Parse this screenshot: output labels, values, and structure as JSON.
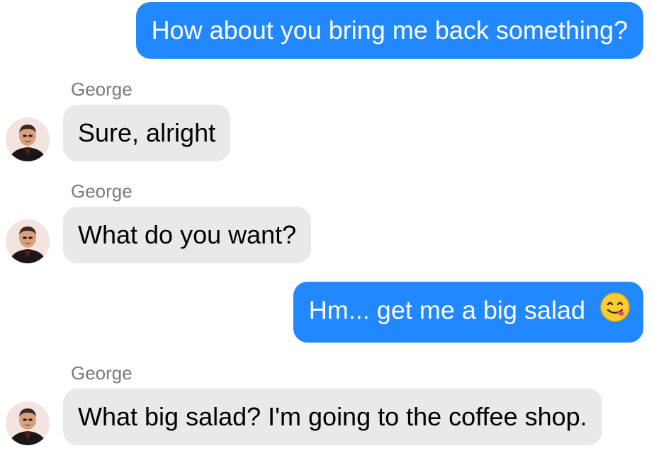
{
  "conversation": {
    "messages": [
      {
        "direction": "outgoing",
        "text": "How about you bring me back something?"
      },
      {
        "direction": "incoming",
        "sender": "George",
        "text": "Sure, alright",
        "avatar_icon": "avatar-george-icon"
      },
      {
        "direction": "incoming",
        "sender": "George",
        "text": "What do you want?",
        "avatar_icon": "avatar-george-icon"
      },
      {
        "direction": "outgoing",
        "text": "Hm... get me a big salad",
        "emoji_icon": "face-savoring-food-emoji-icon"
      },
      {
        "direction": "incoming",
        "sender": "George",
        "text": "What big salad? I'm going to the coffee shop.",
        "avatar_icon": "avatar-george-icon"
      }
    ]
  },
  "colors": {
    "outgoing_bubble": "#2188ff",
    "incoming_bubble": "#e9e9eb",
    "sender_name": "#7a7a7a",
    "background": "#ffffff"
  }
}
